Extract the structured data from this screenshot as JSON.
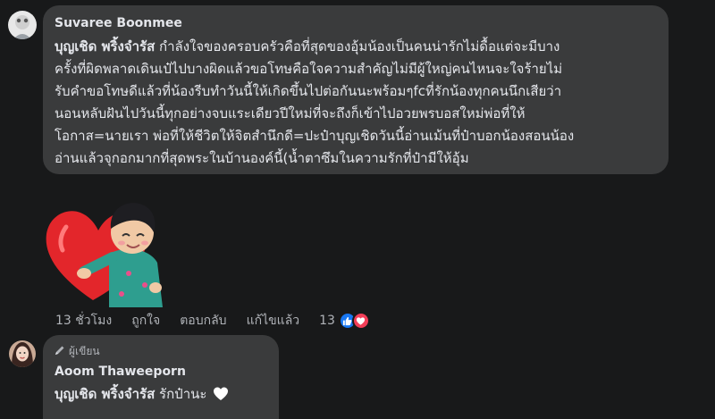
{
  "comment1": {
    "author": "Suvaree Boonmee",
    "tag": "บุญเชิด พริ้งจำรัส",
    "lines": [
      " กำลังใจของครอบครัวคือที่สุดของอุ้มน้องเป็นคนน่ารักไม่ดื้อแต่จะมีบาง",
      "ครั้งที่ผิดพลาดเดินเป๋ไปบางผิดแล้วขอโทษคือใจความสำคัญไม่มีผู้ใหญ่คนไหนจะใจร้ายไม่",
      "รับคำขอโทษดีแล้วที่น้องรีบทำวันนี้ให้เกิดขึ้นไปต่อกันนะพร้อมๆfcที่รักน้องทุกคนนึกเสียว่า",
      "นอนหลับฝันไปวันนี้ทุกอย่างจบแระเดียวปีใหม่ที่จะถึงก็เข้าไปอวยพรบอสใหม่พ่อที่ให้",
      "โอกาส=นายเรา พ่อที่ให้ชีวิตให้จิตสำนึกดี=ปะป๋าบุญเชิดวันนี้อ่านเม้นที่ป๋าบอกน้องสอนน้อง",
      "อ่านแล้วจุกอกมากที่สุดพระในบ้านองค์นี้(น้ำตาซึมในความรักที่ป๋ามีให้อุ้ม"
    ],
    "actions": {
      "time": "13 ชั่วโมง",
      "like": "ถูกใจ",
      "reply": "ตอบกลับ",
      "edited": "แก้ไขแล้ว",
      "reaction_count": "13"
    },
    "sticker": "heart-hug-sticker"
  },
  "comment2": {
    "badge": "ผู้เขียน",
    "author": "Aoom Thaweeporn",
    "tag": "บุญเชิด พริ้งจำรัส",
    "text": " รักป๋านะ "
  },
  "colors": {
    "background": "#18191a",
    "bubble": "#3a3b3c",
    "like_blue": "#1877f2",
    "love_red": "#f33e58"
  }
}
